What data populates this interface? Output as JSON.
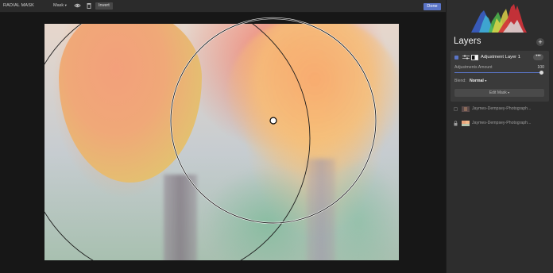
{
  "toolbar": {
    "title": "RADIAL MASK",
    "mask_label": "Mask",
    "invert_label": "Invert",
    "done_label": "Done"
  },
  "panel": {
    "layers_title": "Layers",
    "add_label": "+",
    "adjustment_layer": {
      "name": "Adjustment Layer 1",
      "more_label": "•••",
      "amount_label": "Adjustments Amount",
      "amount_value": "100",
      "blend_label": "Blend:",
      "blend_value": "Normal",
      "edit_mask_label": "Edit Mask"
    },
    "layers": [
      {
        "name": "Jaymes-Dempsey-Photograph..."
      },
      {
        "name": "Jaymes-Dempsey-Photograph..."
      }
    ]
  },
  "icons": {
    "mask_dropdown": "chevron-down-icon",
    "visibility": "eye-icon",
    "delete": "trash-icon",
    "lock": "lock-icon",
    "histogram": "histogram-icon"
  },
  "colors": {
    "accent": "#5a74c6",
    "panel_bg": "#2d2d2d",
    "toolbar_bg": "#2b2b2b"
  }
}
